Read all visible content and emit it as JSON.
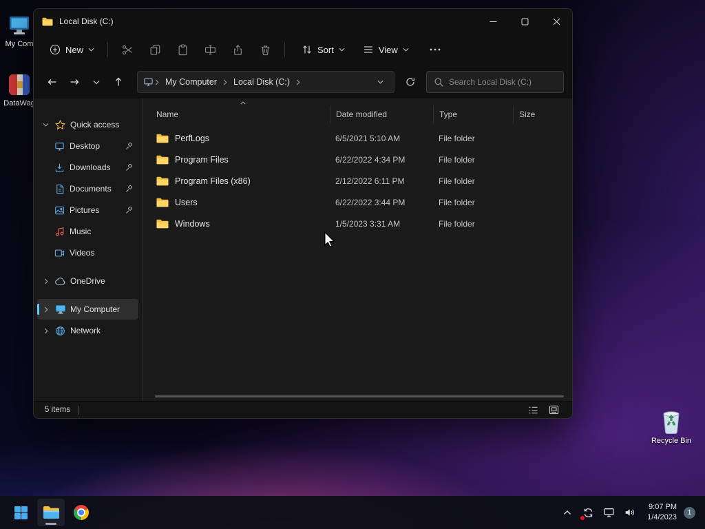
{
  "desktop": {
    "icons": [
      {
        "label": "My Com"
      },
      {
        "label": "DataWag"
      },
      {
        "label": "Recycle Bin"
      }
    ]
  },
  "window": {
    "title": "Local Disk (C:)",
    "toolbar": {
      "new": "New",
      "sort": "Sort",
      "view": "View"
    },
    "address": {
      "crumbs": [
        "My Computer",
        "Local Disk (C:)"
      ],
      "search_placeholder": "Search Local Disk (C:)"
    },
    "sidebar": {
      "items": [
        {
          "label": "Quick access"
        },
        {
          "label": "Desktop"
        },
        {
          "label": "Downloads"
        },
        {
          "label": "Documents"
        },
        {
          "label": "Pictures"
        },
        {
          "label": "Music"
        },
        {
          "label": "Videos"
        },
        {
          "label": "OneDrive"
        },
        {
          "label": "My Computer"
        },
        {
          "label": "Network"
        }
      ]
    },
    "files": {
      "columns": [
        "Name",
        "Date modified",
        "Type",
        "Size"
      ],
      "rows": [
        {
          "name": "PerfLogs",
          "date": "6/5/2021 5:10 AM",
          "type": "File folder",
          "size": ""
        },
        {
          "name": "Program Files",
          "date": "6/22/2022 4:34 PM",
          "type": "File folder",
          "size": ""
        },
        {
          "name": "Program Files (x86)",
          "date": "2/12/2022 6:11 PM",
          "type": "File folder",
          "size": ""
        },
        {
          "name": "Users",
          "date": "6/22/2022 3:44 PM",
          "type": "File folder",
          "size": ""
        },
        {
          "name": "Windows",
          "date": "1/5/2023 3:31 AM",
          "type": "File folder",
          "size": ""
        }
      ]
    },
    "statusbar": {
      "count": "5 items"
    }
  },
  "taskbar": {
    "time": "9:07 PM",
    "date": "1/4/2023",
    "badge": "1"
  }
}
